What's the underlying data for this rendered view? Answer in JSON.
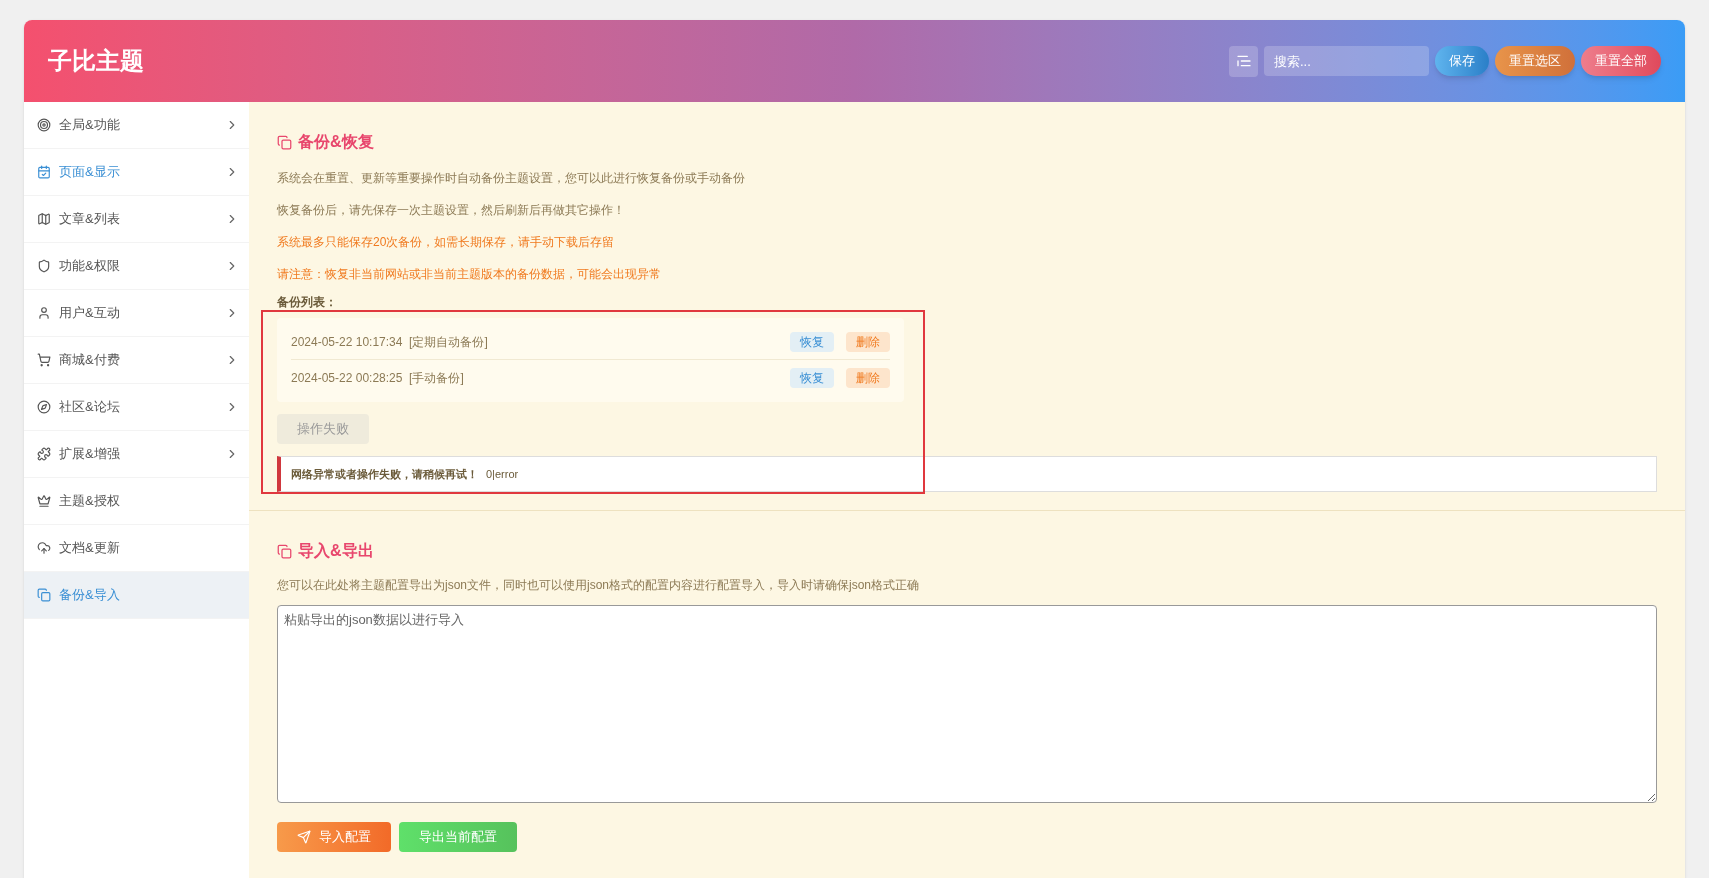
{
  "header": {
    "title": "子比主题",
    "search": {
      "placeholder": "搜索..."
    },
    "buttons": [
      {
        "label": "保存",
        "kind": "save"
      },
      {
        "label": "重置选区",
        "kind": "reset-section"
      },
      {
        "label": "重置全部",
        "kind": "reset-all"
      }
    ]
  },
  "sidebar": {
    "items": [
      {
        "label": "全局&功能",
        "expandable": true,
        "highlighted": false,
        "selected": false
      },
      {
        "label": "页面&显示",
        "expandable": true,
        "highlighted": true,
        "selected": false
      },
      {
        "label": "文章&列表",
        "expandable": true,
        "highlighted": false,
        "selected": false
      },
      {
        "label": "功能&权限",
        "expandable": true,
        "highlighted": false,
        "selected": false
      },
      {
        "label": "用户&互动",
        "expandable": true,
        "highlighted": false,
        "selected": false
      },
      {
        "label": "商城&付费",
        "expandable": true,
        "highlighted": false,
        "selected": false
      },
      {
        "label": "社区&论坛",
        "expandable": true,
        "highlighted": false,
        "selected": false
      },
      {
        "label": "扩展&增强",
        "expandable": true,
        "highlighted": false,
        "selected": false
      },
      {
        "label": "主题&授权",
        "expandable": false,
        "highlighted": false,
        "selected": false
      },
      {
        "label": "文档&更新",
        "expandable": false,
        "highlighted": false,
        "selected": false
      },
      {
        "label": "备份&导入",
        "expandable": false,
        "highlighted": false,
        "selected": true
      }
    ]
  },
  "backup": {
    "title": "备份&恢复",
    "notes": [
      {
        "text": "系统会在重置、更新等重要操作时自动备份主题设置，您可以此进行恢复备份或手动备份",
        "kind": "info"
      },
      {
        "text": "恢复备份后，请先保存一次主题设置，然后刷新后再做其它操作！",
        "kind": "info"
      },
      {
        "text": "系统最多只能保存20次备份，如需长期保存，请手动下载后存留",
        "kind": "warning"
      },
      {
        "text": "请注意：恢复非当前网站或非当前主题版本的备份数据，可能会出现异常",
        "kind": "warning"
      }
    ],
    "list_label": "备份列表：",
    "entries": [
      {
        "time": "2024-05-22 10:17:34",
        "type": "[定期自动备份]",
        "restore": "恢复",
        "delete": "删除"
      },
      {
        "time": "2024-05-22 00:28:25",
        "type": "[手动备份]",
        "restore": "恢复",
        "delete": "删除"
      }
    ],
    "action_button": {
      "label": "操作失败",
      "disabled": true
    },
    "error": {
      "message": "网络异常或者操作失败，请稍候再试！",
      "code": "0|error"
    }
  },
  "import_export": {
    "title": "导入&导出",
    "description": "您可以在此处将主题配置导出为json文件，同时也可以使用json格式的配置内容进行配置导入，导入时请确保json格式正确",
    "textarea": {
      "placeholder": "粘贴导出的json数据以进行导入"
    },
    "buttons": [
      {
        "label": "导入配置",
        "kind": "import"
      },
      {
        "label": "导出当前配置",
        "kind": "export"
      }
    ]
  }
}
